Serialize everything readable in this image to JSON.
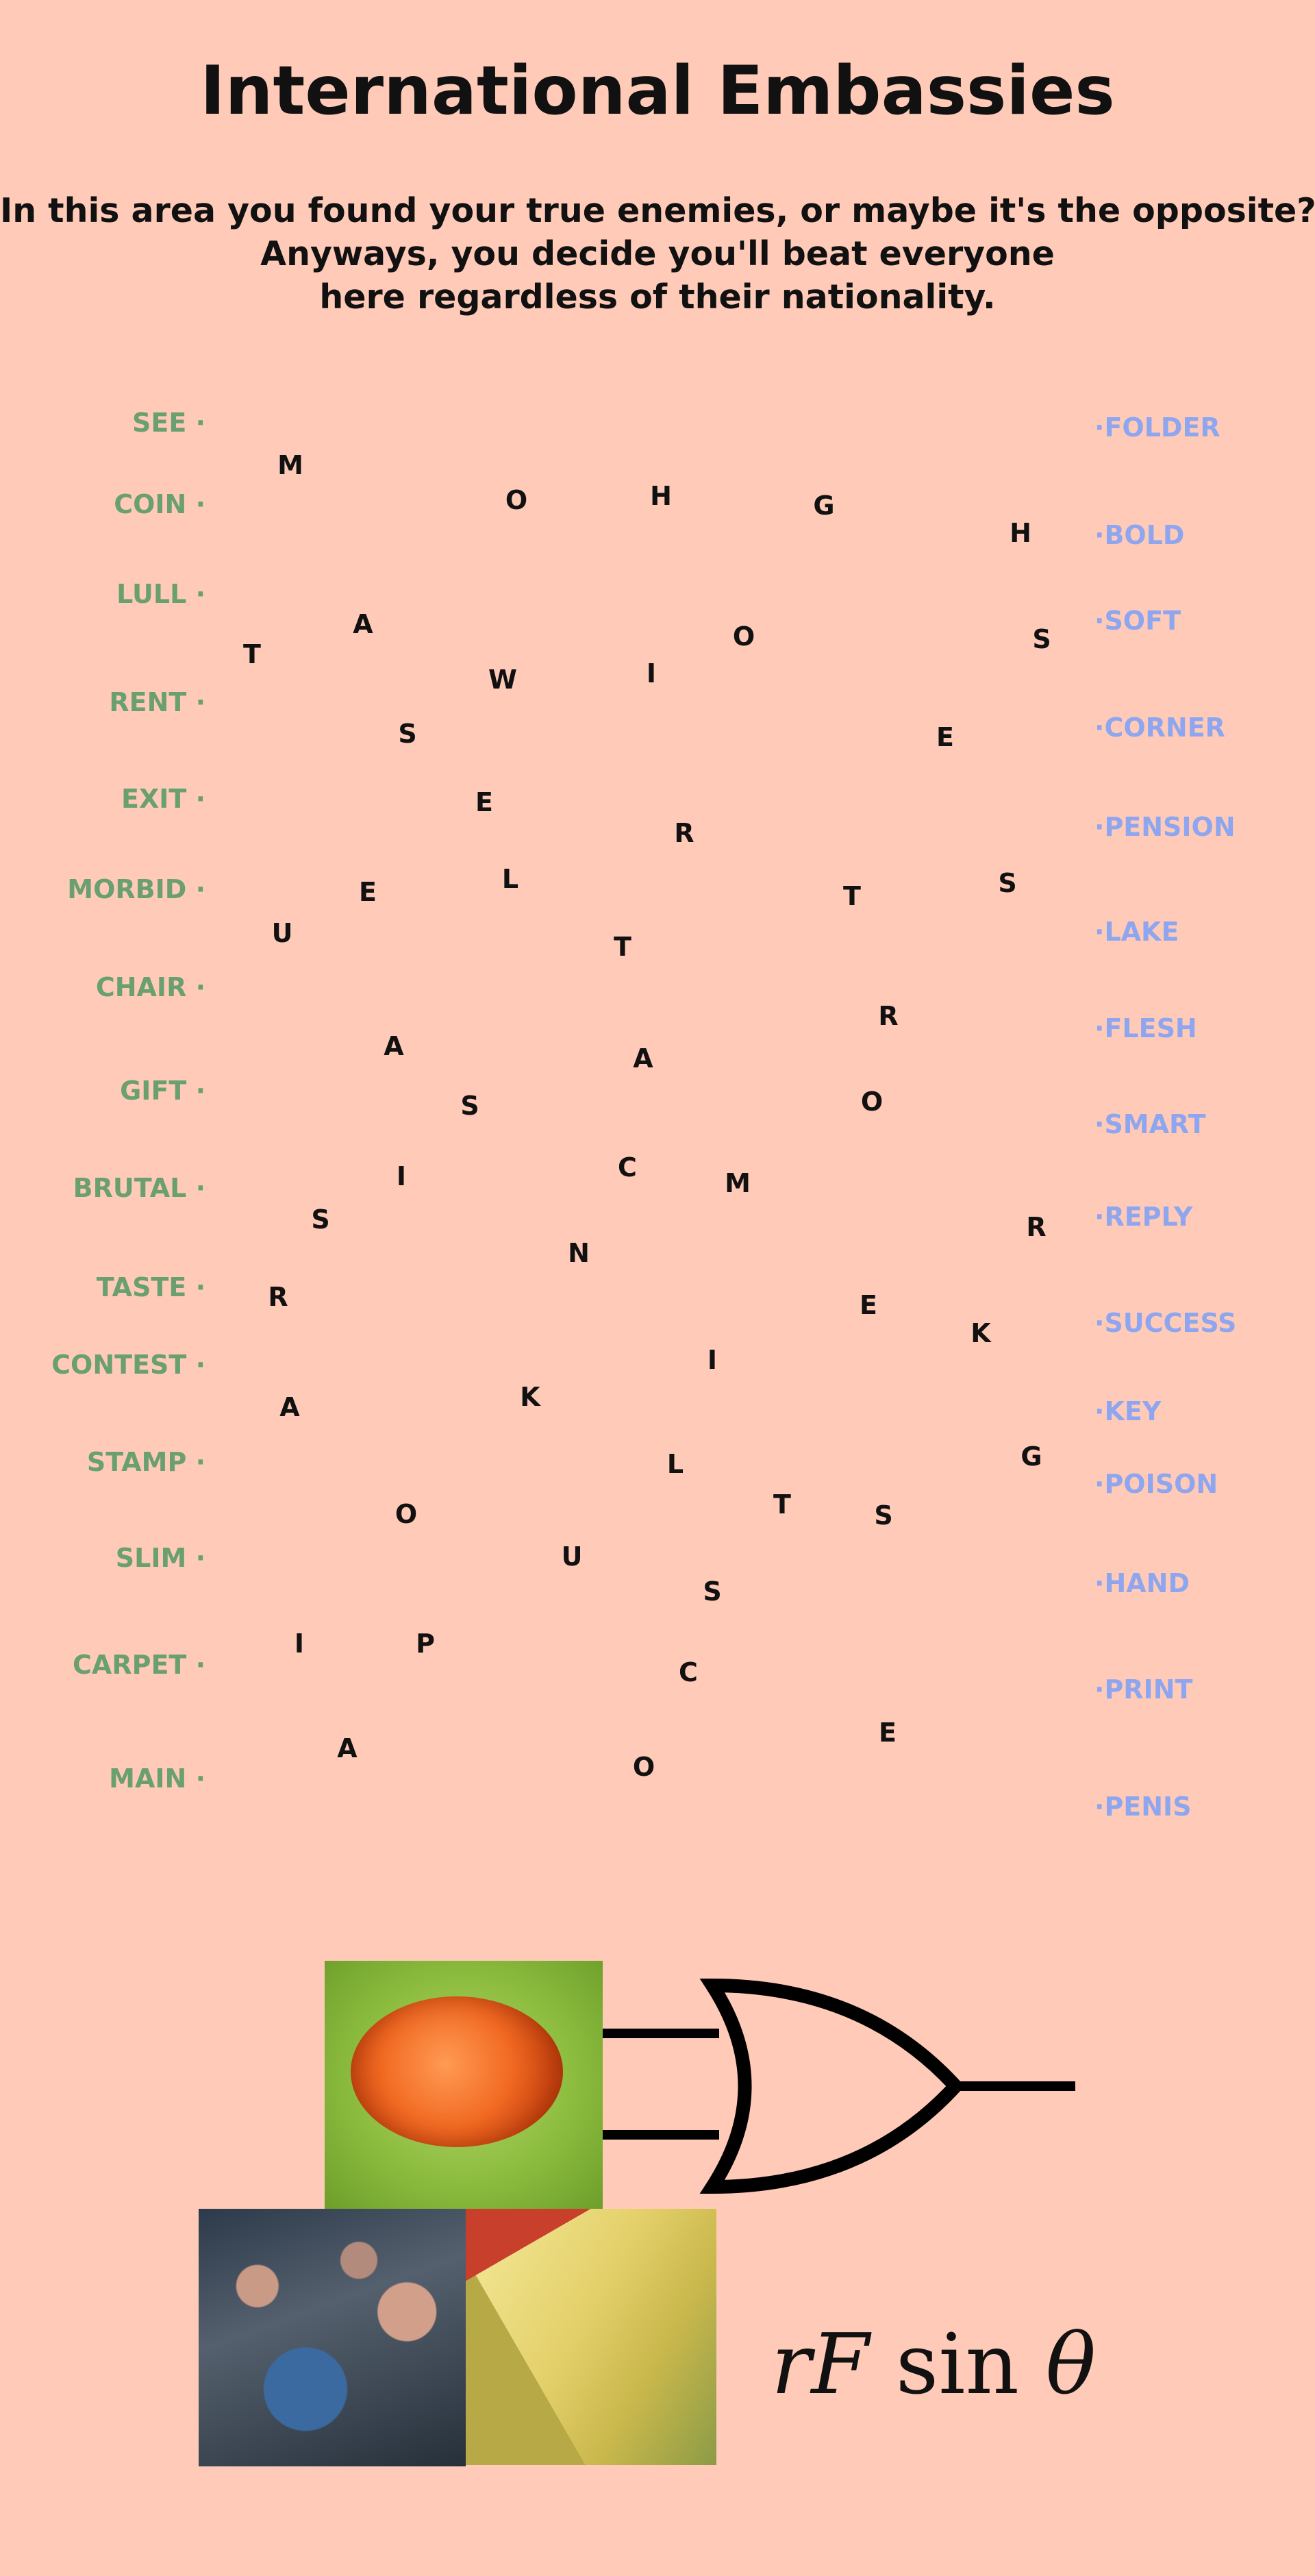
{
  "title": "International Embassies",
  "intro": [
    "In this area you found your true enemies, or maybe it's the opposite?",
    "Anyways, you decide you'll beat everyone",
    "here regardless of their nationality."
  ],
  "colors": {
    "background": "#ffcbb8",
    "left_words": "#6aa070",
    "right_words": "#8ea6ef",
    "grid_letters": "#111111"
  },
  "left_words": [
    "SEE",
    "COIN",
    "LULL",
    "RENT",
    "EXIT",
    "MORBID",
    "CHAIR",
    "GIFT",
    "BRUTAL",
    "TASTE",
    "CONTEST",
    "STAMP",
    "SLIM",
    "CARPET",
    "MAIN"
  ],
  "right_words": [
    "FOLDER",
    "BOLD",
    "SOFT",
    "CORNER",
    "PENSION",
    "LAKE",
    "FLESH",
    "SMART",
    "REPLY",
    "SUCCESS",
    "KEY",
    "POISON",
    "HAND",
    "PRINT",
    "PENIS"
  ],
  "letters": [
    "M",
    "O",
    "H",
    "G",
    "H",
    "A",
    "T",
    "O",
    "S",
    "W",
    "I",
    "S",
    "E",
    "E",
    "R",
    "L",
    "E",
    "T",
    "S",
    "U",
    "T",
    "R",
    "A",
    "A",
    "S",
    "O",
    "I",
    "C",
    "M",
    "S",
    "R",
    "N",
    "R",
    "E",
    "K",
    "I",
    "A",
    "K",
    "G",
    "L",
    "T",
    "S",
    "O",
    "U",
    "S",
    "I",
    "P",
    "C",
    "E",
    "A",
    "O"
  ],
  "formula": {
    "r": "r",
    "F": "F",
    "sin": "sin",
    "theta": "θ"
  },
  "images": [
    "orange-blob-photo",
    "crowd-photo",
    "felt-photo"
  ]
}
